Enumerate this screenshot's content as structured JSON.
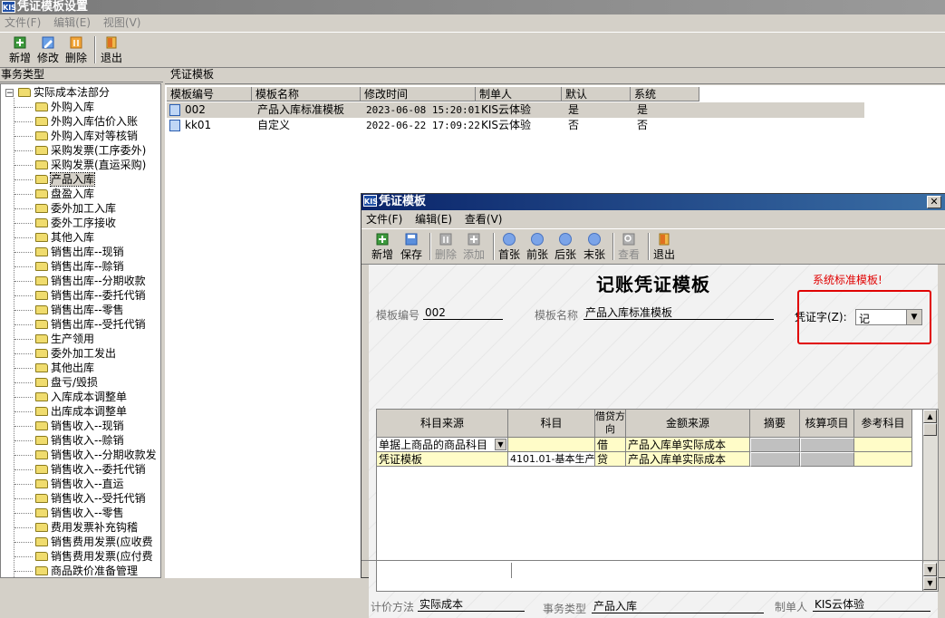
{
  "app": {
    "logo": "KIS",
    "title": "凭证模板设置"
  },
  "menu": [
    "文件(F)",
    "编辑(E)",
    "视图(V)"
  ],
  "toolbar": {
    "add": "新增",
    "edit": "修改",
    "delete": "删除",
    "exit": "退出"
  },
  "left": {
    "header": "事务类型",
    "root": "实际成本法部分",
    "items": [
      "外购入库",
      "外购入库估价入账",
      "外购入库对等核销",
      "采购发票(工序委外)",
      "采购发票(直运采购)",
      "产品入库",
      "盘盈入库",
      "委外加工入库",
      "委外工序接收",
      "其他入库",
      "销售出库--现销",
      "销售出库--赊销",
      "销售出库--分期收款",
      "销售出库--委托代销",
      "销售出库--零售",
      "销售出库--受托代销",
      "生产领用",
      "委外加工发出",
      "其他出库",
      "盘亏/毁损",
      "入库成本调整单",
      "出库成本调整单",
      "销售收入--现销",
      "销售收入--赊销",
      "销售收入--分期收款发",
      "销售收入--委托代销",
      "销售收入--直运",
      "销售收入--受托代销",
      "销售收入--零售",
      "费用发票补充钩稽",
      "销售费用发票(应收费",
      "销售费用发票(应付费",
      "商品跌价准备管理"
    ],
    "selected": "产品入库"
  },
  "right": {
    "header": "凭证模板",
    "columns": [
      "模板编号",
      "模板名称",
      "修改时间",
      "制单人",
      "默认",
      "系统"
    ],
    "rows": [
      [
        "002",
        "产品入库标准模板",
        "2023-06-08 15:20:01",
        "KIS云体验",
        "是",
        "是"
      ],
      [
        "kk01",
        "自定义",
        "2022-06-22 17:09:22",
        "KIS云体验",
        "否",
        "否"
      ]
    ]
  },
  "dialog": {
    "title": "凭证模板",
    "close": "✕",
    "menu": [
      "文件(F)",
      "编辑(E)",
      "查看(V)"
    ],
    "toolbar": {
      "add": "新增",
      "save": "保存",
      "delete": "删除",
      "insert": "添加",
      "first": "首张",
      "prev": "前张",
      "next": "后张",
      "last": "末张",
      "view": "查看",
      "exit": "退出"
    },
    "heading": "记账凭证模板",
    "system_tag": "系统标准模板!",
    "fields": {
      "code_label": "模板编号",
      "code": "002",
      "name_label": "模板名称",
      "name": "产品入库标准模板",
      "word_label": "凭证字(Z):",
      "word": "记",
      "pricing_label": "计价方法",
      "pricing": "实际成本",
      "biz_label": "事务类型",
      "biz": "产品入库",
      "maker_label": "制单人",
      "maker": "KIS云体验"
    },
    "grid": {
      "headers": [
        "科目来源",
        "科目",
        "借贷方向",
        "金额来源",
        "摘要",
        "核算项目",
        "参考科目"
      ],
      "rows": [
        [
          "单据上商品的商品科目",
          "",
          "借",
          "产品入库单实际成本"
        ],
        [
          "凭证模板",
          "4101.01-基本生产",
          "贷",
          "产品入库单实际成本"
        ]
      ]
    }
  }
}
